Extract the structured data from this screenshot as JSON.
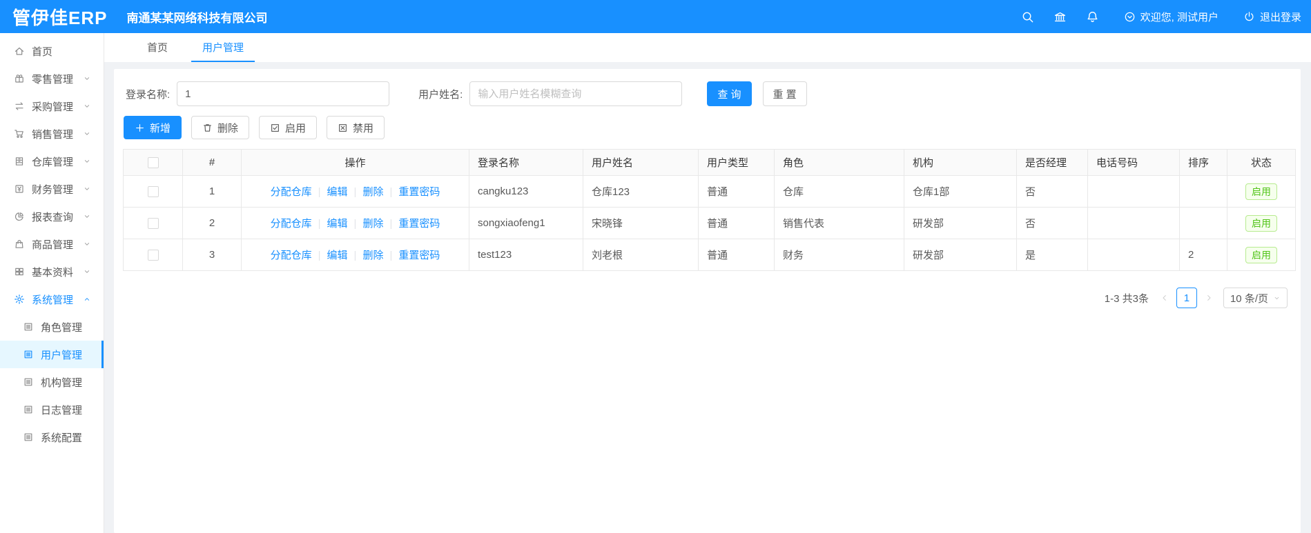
{
  "topbar": {
    "logo": "管伊佳ERP",
    "company": "南通某某网络科技有限公司",
    "welcome": "欢迎您, 测试用户",
    "logout": "退出登录"
  },
  "sidebar": {
    "items": [
      {
        "key": "home",
        "icon": "home",
        "label": "首页",
        "expandable": false
      },
      {
        "key": "retail",
        "icon": "gift",
        "label": "零售管理",
        "expandable": true
      },
      {
        "key": "purchase",
        "icon": "swap",
        "label": "采购管理",
        "expandable": true
      },
      {
        "key": "sales",
        "icon": "cart",
        "label": "销售管理",
        "expandable": true
      },
      {
        "key": "warehouse",
        "icon": "warehouse",
        "label": "仓库管理",
        "expandable": true
      },
      {
        "key": "finance",
        "icon": "finance",
        "label": "财务管理",
        "expandable": true
      },
      {
        "key": "report",
        "icon": "pie",
        "label": "报表查询",
        "expandable": true
      },
      {
        "key": "goods",
        "icon": "bag",
        "label": "商品管理",
        "expandable": true
      },
      {
        "key": "basic",
        "icon": "grid",
        "label": "基本资料",
        "expandable": true
      },
      {
        "key": "system",
        "icon": "gear",
        "label": "系统管理",
        "expandable": true,
        "expanded": true,
        "active": true
      }
    ],
    "subitems": [
      {
        "key": "role",
        "icon": "doc",
        "label": "角色管理"
      },
      {
        "key": "user",
        "icon": "doc",
        "label": "用户管理",
        "active": true
      },
      {
        "key": "org",
        "icon": "doc",
        "label": "机构管理"
      },
      {
        "key": "log",
        "icon": "doc",
        "label": "日志管理"
      },
      {
        "key": "config",
        "icon": "doc",
        "label": "系统配置"
      }
    ]
  },
  "tabs": [
    {
      "key": "home",
      "label": "首页"
    },
    {
      "key": "user-management",
      "label": "用户管理",
      "active": true
    }
  ],
  "filters": {
    "login_name_label": "登录名称:",
    "login_name_value": "1",
    "user_name_label": "用户姓名:",
    "user_name_placeholder": "输入用户姓名模糊查询",
    "search_label": "查 询",
    "reset_label": "重 置"
  },
  "toolbar": {
    "add": "新增",
    "delete": "删除",
    "enable": "启用",
    "disable": "禁用"
  },
  "table": {
    "headers": [
      {
        "key": "index",
        "label": "#"
      },
      {
        "key": "actions",
        "label": "操作"
      },
      {
        "key": "login-name",
        "label": "登录名称"
      },
      {
        "key": "user-name",
        "label": "用户姓名"
      },
      {
        "key": "user-type",
        "label": "用户类型"
      },
      {
        "key": "role",
        "label": "角色"
      },
      {
        "key": "org",
        "label": "机构"
      },
      {
        "key": "is-manager",
        "label": "是否经理"
      },
      {
        "key": "phone",
        "label": "电话号码"
      },
      {
        "key": "sort",
        "label": "排序"
      },
      {
        "key": "status",
        "label": "状态"
      }
    ],
    "action_links": [
      {
        "key": "assign-warehouse",
        "label": "分配仓库"
      },
      {
        "key": "edit",
        "label": "编辑"
      },
      {
        "key": "delete",
        "label": "删除"
      },
      {
        "key": "reset-password",
        "label": "重置密码"
      }
    ],
    "rows": [
      {
        "index": "1",
        "login": "cangku123",
        "name": "仓库123",
        "type": "普通",
        "role": "仓库",
        "org": "仓库1部",
        "manager": "否",
        "phone": "",
        "sort": "",
        "status": "启用"
      },
      {
        "index": "2",
        "login": "songxiaofeng1",
        "name": "宋晓锋",
        "type": "普通",
        "role": "销售代表",
        "org": "研发部",
        "manager": "否",
        "phone": "",
        "sort": "",
        "status": "启用"
      },
      {
        "index": "3",
        "login": "test123",
        "name": "刘老根",
        "type": "普通",
        "role": "财务",
        "org": "研发部",
        "manager": "是",
        "phone": "",
        "sort": "2",
        "status": "启用"
      }
    ]
  },
  "pagination": {
    "total": "1-3 共3条",
    "current_page": "1",
    "page_size": "10 条/页"
  },
  "colors": {
    "primary": "#1890ff",
    "topbar_bg": "#1890ff",
    "success_text": "#52c41a",
    "success_bg": "#f6ffed",
    "success_border": "#b7eb8f"
  }
}
